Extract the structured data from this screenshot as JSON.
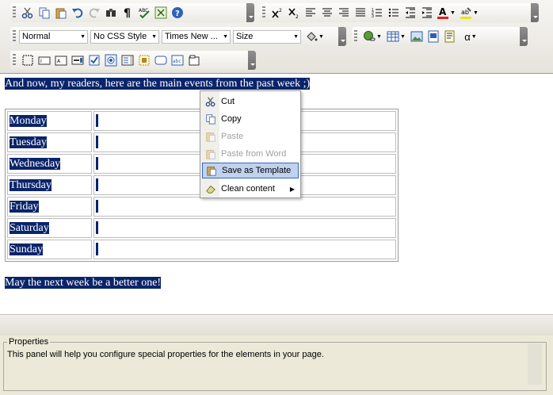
{
  "toolbar": {
    "format_combo": "Normal",
    "css_combo": "No CSS Style",
    "font_combo": "Times New ...",
    "size_combo": "Size",
    "special_char_label": "α"
  },
  "editor": {
    "intro": "And now, my readers, here are the main events from the past week ;)",
    "days": [
      "Monday",
      "Tuesday",
      "Wednesday",
      "Thursday",
      "Friday",
      "Saturday",
      "Sunday"
    ],
    "outro": "May the next week be a better one!"
  },
  "context_menu": {
    "items": [
      {
        "label": "Cut",
        "icon": "cut-icon",
        "enabled": true
      },
      {
        "label": "Copy",
        "icon": "copy-icon",
        "enabled": true
      },
      {
        "label": "Paste",
        "icon": "paste-icon",
        "enabled": false
      },
      {
        "label": "Paste from Word",
        "icon": "paste-word-icon",
        "enabled": false
      },
      {
        "label": "Save as Template",
        "icon": "save-template-icon",
        "enabled": true,
        "highlighted": true
      },
      {
        "label": "Clean content",
        "icon": "eraser-icon",
        "enabled": true,
        "submenu": true
      }
    ]
  },
  "properties": {
    "legend": "Properties",
    "text": "This panel will help you configure special properties for the elements in your page."
  },
  "colors": {
    "selection": "#0a246a",
    "menu_highlight": "#c1d2ee",
    "panel_bg": "#ece9d8"
  }
}
